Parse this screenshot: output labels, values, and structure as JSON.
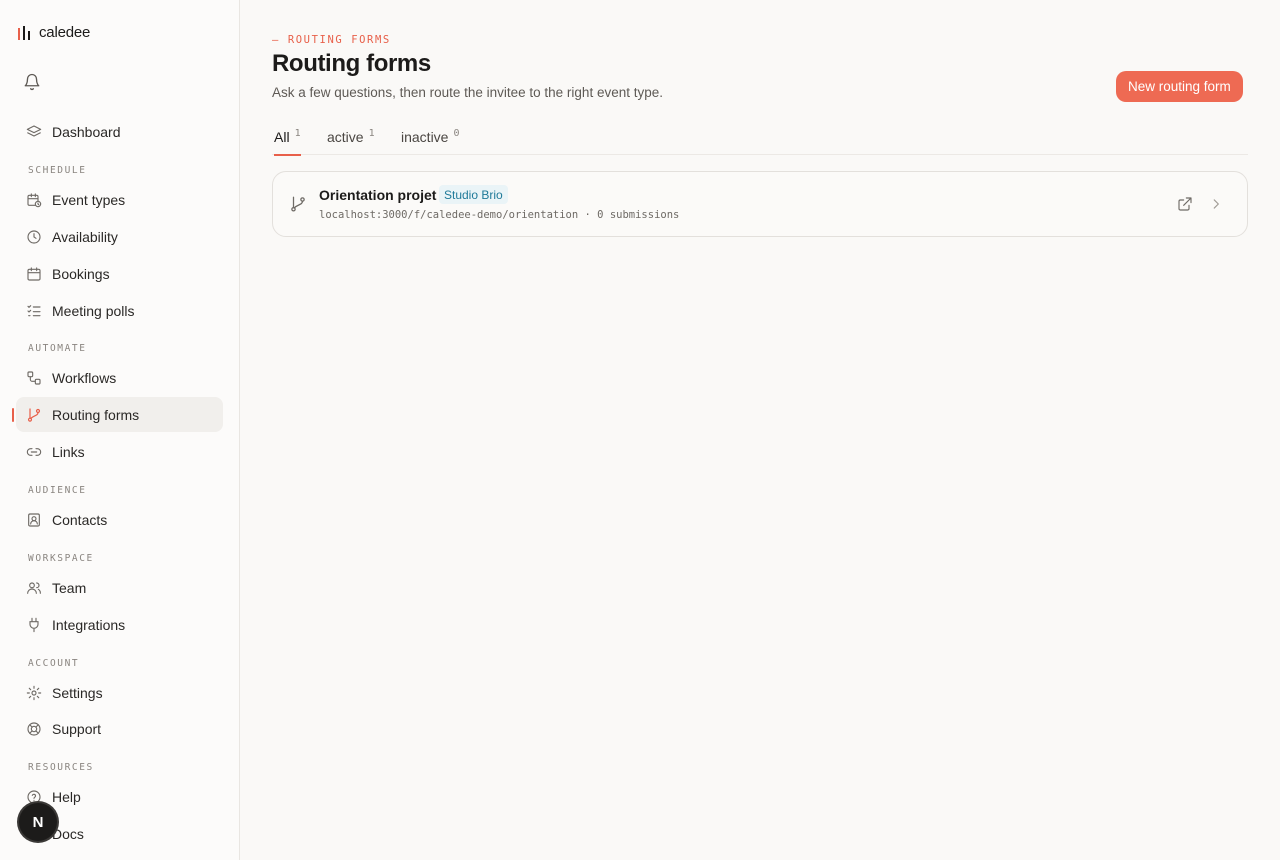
{
  "app": {
    "name": "caledee"
  },
  "sidebar": {
    "top_item": {
      "label": "Dashboard",
      "icon": "layers-icon"
    },
    "sections": [
      {
        "label": "SCHEDULE",
        "items": [
          {
            "label": "Event types",
            "icon": "calendar-clock-icon"
          },
          {
            "label": "Availability",
            "icon": "clock-icon"
          },
          {
            "label": "Bookings",
            "icon": "calendar-icon"
          },
          {
            "label": "Meeting polls",
            "icon": "list-checks-icon"
          }
        ]
      },
      {
        "label": "AUTOMATE",
        "items": [
          {
            "label": "Workflows",
            "icon": "workflow-icon"
          },
          {
            "label": "Routing forms",
            "icon": "git-branch-icon",
            "active": true
          },
          {
            "label": "Links",
            "icon": "link-icon"
          }
        ]
      },
      {
        "label": "AUDIENCE",
        "items": [
          {
            "label": "Contacts",
            "icon": "contact-icon"
          }
        ]
      },
      {
        "label": "WORKSPACE",
        "items": [
          {
            "label": "Team",
            "icon": "users-icon"
          },
          {
            "label": "Integrations",
            "icon": "plug-icon"
          }
        ]
      },
      {
        "label": "ACCOUNT",
        "items": [
          {
            "label": "Settings",
            "icon": "gear-icon"
          },
          {
            "label": "Support",
            "icon": "life-buoy-icon"
          }
        ]
      },
      {
        "label": "RESOURCES",
        "items": [
          {
            "label": "Help",
            "icon": "help-circle-icon"
          },
          {
            "label": "Docs",
            "icon": "docs-icon"
          }
        ]
      }
    ],
    "floating_badge": "N"
  },
  "header": {
    "eyebrow": "— ROUTING FORMS",
    "title": "Routing forms",
    "subtitle": "Ask a few questions, then route the invitee to the right event type.",
    "new_button": "New routing form"
  },
  "tabs": [
    {
      "label": "All",
      "count": "1",
      "active": true
    },
    {
      "label": "active",
      "count": "1"
    },
    {
      "label": "inactive",
      "count": "0"
    }
  ],
  "forms": [
    {
      "title": "Orientation projet",
      "badge": "Studio Brio",
      "url": "localhost:3000/f/caledee-demo/orientation",
      "separator": "·",
      "submissions": "0 submissions"
    }
  ],
  "colors": {
    "accent": "#e8604a",
    "button": "#ee6a53",
    "badge_text": "#1f7a99",
    "badge_bg": "#eaf4f7"
  }
}
